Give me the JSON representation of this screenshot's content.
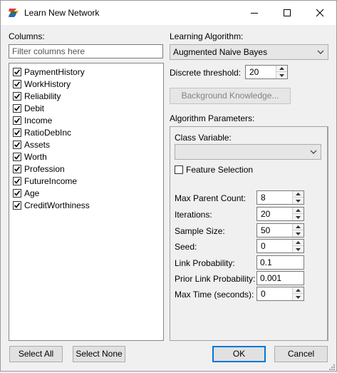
{
  "window": {
    "title": "Learn New Network",
    "icon": "network-app-icon"
  },
  "columns": {
    "label": "Columns:",
    "filter_placeholder": "Filter columns here",
    "items": [
      {
        "label": "PaymentHistory",
        "checked": true
      },
      {
        "label": "WorkHistory",
        "checked": true
      },
      {
        "label": "Reliability",
        "checked": true
      },
      {
        "label": "Debit",
        "checked": true
      },
      {
        "label": "Income",
        "checked": true
      },
      {
        "label": "RatioDebInc",
        "checked": true
      },
      {
        "label": "Assets",
        "checked": true
      },
      {
        "label": "Worth",
        "checked": true
      },
      {
        "label": "Profession",
        "checked": true
      },
      {
        "label": "FutureIncome",
        "checked": true
      },
      {
        "label": "Age",
        "checked": true
      },
      {
        "label": "CreditWorthiness",
        "checked": true
      }
    ],
    "select_all": "Select All",
    "select_none": "Select None"
  },
  "algorithm": {
    "label": "Learning Algorithm:",
    "selected": "Augmented Naive Bayes",
    "discrete_threshold_label": "Discrete threshold:",
    "discrete_threshold_value": "20",
    "background_knowledge": "Background Knowledge..."
  },
  "params": {
    "label": "Algorithm Parameters:",
    "class_variable_label": "Class Variable:",
    "class_variable_value": "",
    "feature_selection_label": "Feature Selection",
    "feature_selection_checked": false,
    "max_parent_count_label": "Max Parent Count:",
    "max_parent_count": "8",
    "iterations_label": "Iterations:",
    "iterations": "20",
    "sample_size_label": "Sample Size:",
    "sample_size": "50",
    "seed_label": "Seed:",
    "seed": "0",
    "link_probability_label": "Link Probability:",
    "link_probability": "0.1",
    "prior_link_probability_label": "Prior Link Probability:",
    "prior_link_probability": "0.001",
    "max_time_label": "Max Time (seconds):",
    "max_time": "0"
  },
  "footer": {
    "ok": "OK",
    "cancel": "Cancel"
  },
  "colors": {
    "accent": "#0078d7",
    "window_bg": "#f0f0f0"
  }
}
